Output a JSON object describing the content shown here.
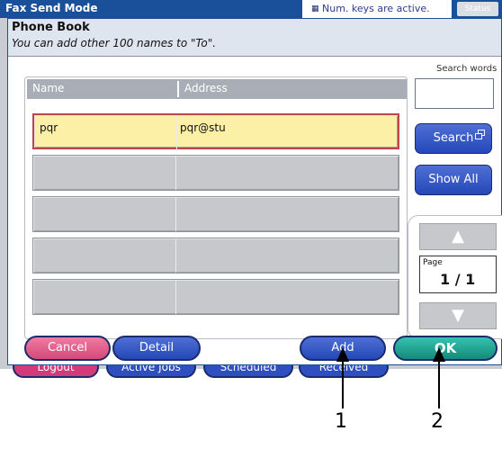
{
  "titlebar": {
    "title": "Fax Send Mode",
    "num_keys_icon": "▦",
    "num_keys_text": "Num. keys are active.",
    "status_label": "Status"
  },
  "dialog": {
    "title": "Phone Book",
    "subtitle": "You can add other 100 names to \"To\".",
    "table": {
      "headers": {
        "name": "Name",
        "address": "Address"
      },
      "rows": [
        {
          "name": "pqr",
          "address": "pqr@stu",
          "selected": true
        },
        {
          "name": "",
          "address": "",
          "selected": false
        },
        {
          "name": "",
          "address": "",
          "selected": false
        },
        {
          "name": "",
          "address": "",
          "selected": false
        },
        {
          "name": "",
          "address": "",
          "selected": false
        }
      ]
    },
    "search": {
      "label": "Search words",
      "value": "",
      "search_button": "Search",
      "search_icon": "window-icon",
      "show_all_button": "Show All"
    },
    "pager": {
      "up_icon": "▲",
      "down_icon": "▼",
      "page_label": "Page",
      "page_value": "1 / 1"
    },
    "buttons": {
      "cancel": "Cancel",
      "detail": "Detail",
      "add": "Add",
      "ok": "OK"
    }
  },
  "background_tabs": [
    "Logout",
    "Active Jobs",
    "Scheduled",
    "Received"
  ],
  "callouts": [
    "1",
    "2"
  ],
  "colors": {
    "titlebar": "#1a4f9a",
    "cancel": "#e05a86",
    "blue_button": "#2f4fc0",
    "ok": "#1f9a8a",
    "selected_row": "#fbf0a6"
  }
}
